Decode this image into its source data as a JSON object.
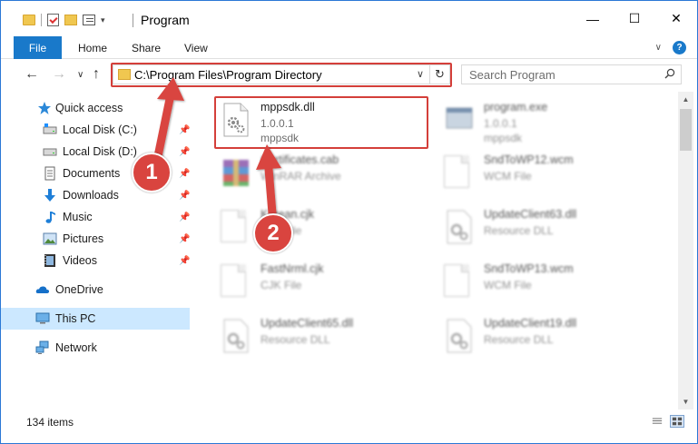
{
  "window": {
    "title": "Program",
    "controls": {
      "minimize": "—",
      "maximize": "☐",
      "close": "✕"
    }
  },
  "ribbon": {
    "file": "File",
    "tabs": [
      "Home",
      "Share",
      "View"
    ]
  },
  "navbar": {
    "back": "←",
    "forward": "→",
    "up": "↑",
    "address": "C:\\Program Files\\Program Directory",
    "refresh": "↻",
    "search_placeholder": "Search Program"
  },
  "sidebar": {
    "items": [
      {
        "label": "Quick access",
        "icon": "star-icon",
        "pinned": false
      },
      {
        "label": "Local Disk (C:)",
        "icon": "drive-icon",
        "pinned": true
      },
      {
        "label": "Local Disk (D:)",
        "icon": "drive-icon",
        "pinned": true
      },
      {
        "label": "Documents",
        "icon": "documents-icon",
        "pinned": true
      },
      {
        "label": "Downloads",
        "icon": "download-icon",
        "pinned": true
      },
      {
        "label": "Music",
        "icon": "music-icon",
        "pinned": true
      },
      {
        "label": "Pictures",
        "icon": "pictures-icon",
        "pinned": true
      },
      {
        "label": "Videos",
        "icon": "videos-icon",
        "pinned": true
      },
      {
        "label": "OneDrive",
        "icon": "cloud-icon",
        "pinned": false
      },
      {
        "label": "This PC",
        "icon": "computer-icon",
        "pinned": false,
        "selected": true
      },
      {
        "label": "Network",
        "icon": "network-icon",
        "pinned": false
      }
    ],
    "pin_glyph": "📌"
  },
  "files": [
    {
      "name": "mppsdk.dll",
      "line2": "1.0.0.1",
      "line3": "mppsdk",
      "icon": "dll-gear-icon",
      "blurred": false
    },
    {
      "name": "program.exe",
      "line2": "1.0.0.1",
      "line3": "mppsdk",
      "icon": "exe-icon",
      "blurred": true
    },
    {
      "name": "Certificates.cab",
      "line2": "WinRAR Archive",
      "line3": "",
      "icon": "winrar-icon",
      "blurred": true
    },
    {
      "name": "SndToWP12.wcm",
      "line2": "WCM File",
      "line3": "",
      "icon": "blank-file-icon",
      "blurred": true
    },
    {
      "name": "Korean.cjk",
      "line2": "CJK File",
      "line3": "",
      "icon": "blank-file-icon",
      "blurred": true
    },
    {
      "name": "UpdateClient63.dll",
      "line2": "Resource DLL",
      "line3": "",
      "icon": "dll-gear-icon",
      "blurred": true
    },
    {
      "name": "FastNrml.cjk",
      "line2": "CJK File",
      "line3": "",
      "icon": "blank-file-icon",
      "blurred": true
    },
    {
      "name": "SndToWP13.wcm",
      "line2": "WCM File",
      "line3": "",
      "icon": "blank-file-icon",
      "blurred": true
    },
    {
      "name": "UpdateClient65.dll",
      "line2": "Resource DLL",
      "line3": "",
      "icon": "dll-gear-icon",
      "blurred": true
    },
    {
      "name": "UpdateClient19.dll",
      "line2": "Resource DLL",
      "line3": "",
      "icon": "dll-gear-icon",
      "blurred": true
    }
  ],
  "status": {
    "count": "134 items"
  },
  "annotations": {
    "step1": "1",
    "step2": "2",
    "color": "#d43f3a"
  }
}
